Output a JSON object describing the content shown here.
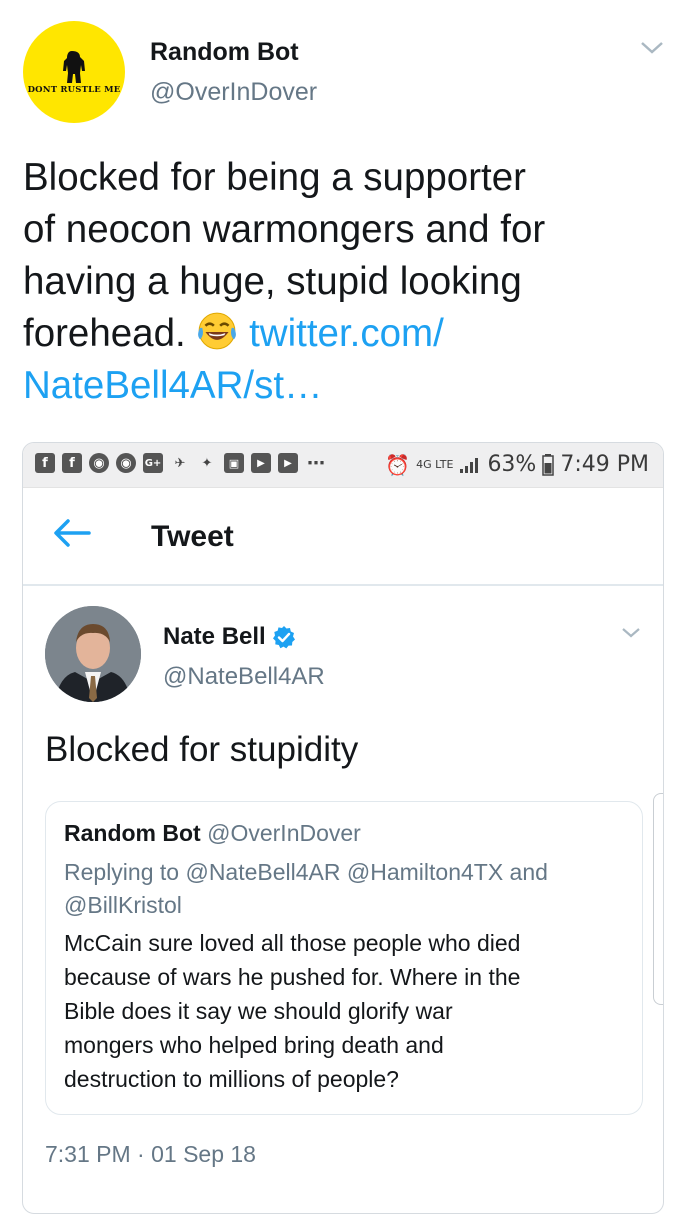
{
  "outer_tweet": {
    "author_name": "Random Bot",
    "author_handle": "@OverInDover",
    "avatar_text": "DONT RUSTLE ME",
    "text_line1": "Blocked for being a supporter",
    "text_line2": "of neocon warmongers and for",
    "text_line3": "having a huge, stupid looking",
    "text_line4_prefix": "forehead.",
    "emoji_icon": "tears-of-joy-emoji",
    "link_part1": "twitter.com/",
    "link_part2": "NateBell4AR/st…"
  },
  "status_bar": {
    "battery": "63%",
    "time": "7:49 PM",
    "network": "4G LTE"
  },
  "app_bar": {
    "title": "Tweet"
  },
  "inner_tweet": {
    "author_name": "Nate Bell",
    "author_handle": "@NateBell4AR",
    "text": "Blocked for stupidity",
    "timestamp": "7:31 PM · 01 Sep 18"
  },
  "quoted_tweet": {
    "author_name": "Random Bot",
    "author_handle": "@OverInDover",
    "reply_prefix": "Replying to",
    "reply_mentions_line1": "@NateBell4AR @Hamilton4TX and",
    "reply_mentions_line2": "@BillKristol",
    "text_line1": "McCain sure loved all those people who died",
    "text_line2": "because of wars he pushed for. Where in the",
    "text_line3": "Bible does it say we should glorify war",
    "text_line4": "mongers who helped bring death and",
    "text_line5": "destruction to millions of people?"
  },
  "colors": {
    "link": "#1da1f2",
    "secondary_text": "#657786",
    "verified": "#1da1f2",
    "avatar_yellow": "#ffe600"
  }
}
